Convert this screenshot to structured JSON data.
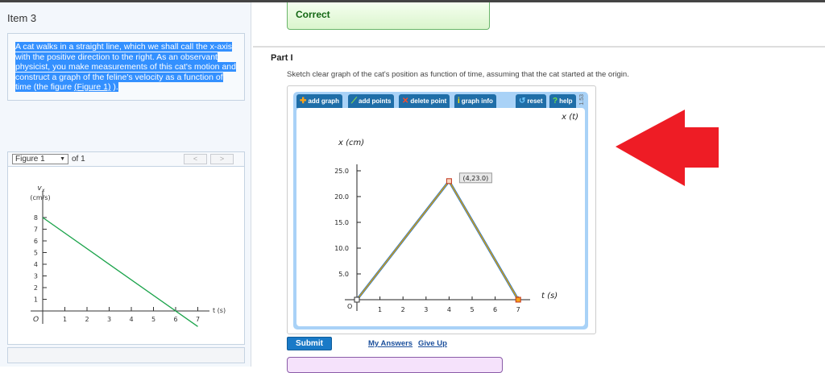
{
  "left": {
    "item_title": "Item 3",
    "question_text": "A cat walks in a straight line, which we shall call the x-axis with the positive direction to the right. As an observant physicist, you make measurements of this cat's motion and construct a graph of the feline's velocity as a function of time (the figure ",
    "question_link": "(Figure 1)",
    "question_end": " ).",
    "figure_select": "Figure 1",
    "figure_of": "of 1",
    "prev": "<",
    "next": ">"
  },
  "right": {
    "feedback": "Correct",
    "part_label": "Part I",
    "instructions": "Sketch clear graph of the cat's position as function of time, assuming that the cat started at the origin.",
    "toolbar": {
      "add_graph": "add graph",
      "add_points": "add points",
      "delete_point": "delete point",
      "graph_info": "graph info",
      "reset": "reset",
      "help": "help",
      "version": "1.53"
    },
    "submit": "Submit",
    "my_answers": "My Answers",
    "give_up": "Give Up"
  },
  "chart_data": [
    {
      "type": "line",
      "title": "",
      "xlabel": "t (s)",
      "ylabel_top": "v",
      "ylabel_sub": "x",
      "ylabel_unit": "(cm/s)",
      "origin_label": "O",
      "x_ticks": [
        "1",
        "2",
        "3",
        "4",
        "5",
        "6",
        "7"
      ],
      "y_ticks": [
        "1",
        "2",
        "3",
        "4",
        "5",
        "6",
        "7",
        "8"
      ],
      "xlim": [
        0,
        7.5
      ],
      "ylim": [
        -1.5,
        9
      ],
      "series": [
        {
          "name": "v_x",
          "x": [
            0,
            7
          ],
          "y": [
            8,
            -1.333
          ],
          "color": "#1aa34a"
        }
      ]
    },
    {
      "type": "line",
      "title": "x (t)",
      "xlabel": "t (s)",
      "ylabel": "x (cm)",
      "origin_label": "O",
      "x_ticks": [
        "1",
        "2",
        "3",
        "4",
        "5",
        "6",
        "7"
      ],
      "y_ticks": [
        "5.0",
        "10.0",
        "15.0",
        "20.0",
        "25.0"
      ],
      "xlim": [
        0,
        7.5
      ],
      "ylim": [
        0,
        27
      ],
      "annotation": "(4,23.0)",
      "series": [
        {
          "name": "x(t)",
          "x": [
            0,
            4,
            7
          ],
          "y": [
            0,
            23,
            0
          ],
          "color": "#e6a100"
        }
      ]
    }
  ],
  "arrow_color": "#ee1c25"
}
